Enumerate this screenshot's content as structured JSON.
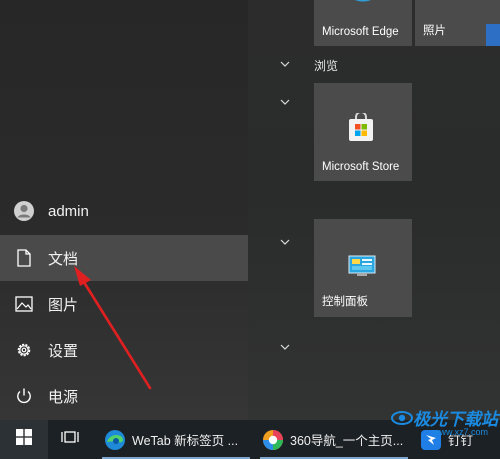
{
  "left_rail": {
    "items": [
      {
        "key": "user",
        "label": "admin",
        "icon": "user-icon"
      },
      {
        "key": "documents",
        "label": "文档",
        "icon": "document-icon"
      },
      {
        "key": "pictures",
        "label": "图片",
        "icon": "picture-icon"
      },
      {
        "key": "settings",
        "label": "设置",
        "icon": "gear-icon"
      },
      {
        "key": "power",
        "label": "电源",
        "icon": "power-icon"
      }
    ]
  },
  "tiles": {
    "edge": {
      "label": "Microsoft Edge",
      "icon": "edge-icon"
    },
    "photos": {
      "label": "照片",
      "icon": "photos-icon"
    },
    "group_browse": {
      "label": "浏览"
    },
    "store": {
      "label": "Microsoft Store",
      "icon": "store-icon"
    },
    "control_panel": {
      "label": "控制面板",
      "icon": "control-panel-icon"
    }
  },
  "taskbar": {
    "start_icon": "windows-icon",
    "task_view_icon": "task-view-icon",
    "apps": [
      {
        "label": "WeTab 新标签页 ...",
        "icon": "edge-icon"
      },
      {
        "label": "360导航_一个主页...",
        "icon": "360-browser-icon"
      },
      {
        "label": "钉钉",
        "icon": "dingtalk-icon"
      }
    ]
  },
  "watermark": {
    "text": "极光下载站",
    "site": "www.xz7.com"
  },
  "annotation": {
    "color": "#e02020"
  }
}
